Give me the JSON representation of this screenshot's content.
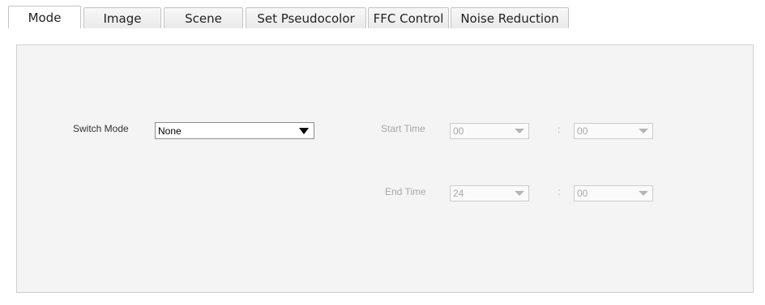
{
  "tabs": [
    {
      "label": "Mode"
    },
    {
      "label": "Image"
    },
    {
      "label": "Scene"
    },
    {
      "label": "Set Pseudocolor"
    },
    {
      "label": "FFC Control"
    },
    {
      "label": "Noise Reduction"
    }
  ],
  "form": {
    "switch_mode_label": "Switch Mode",
    "switch_mode_value": "None",
    "start_time_label": "Start Time",
    "start_hour": "00",
    "start_minute": "00",
    "end_time_label": "End Time",
    "end_hour": "24",
    "end_minute": "00",
    "separator": ":"
  }
}
